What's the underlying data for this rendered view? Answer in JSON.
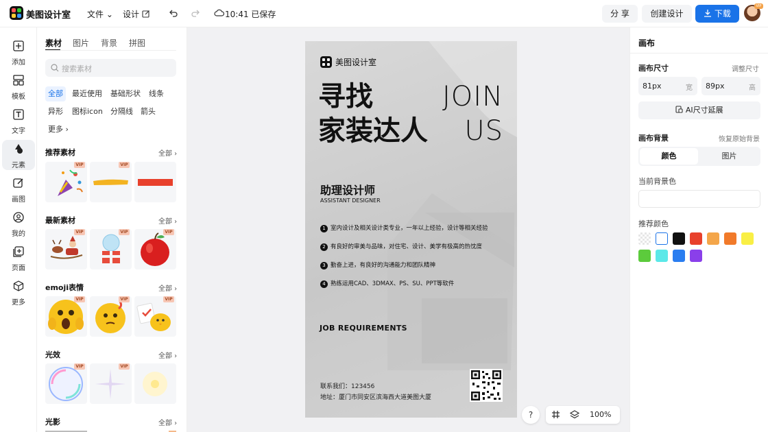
{
  "header": {
    "brand": "美图设计室",
    "file": "文件",
    "design": "设计",
    "save_status": "10:41 已保存",
    "share": "分 享",
    "create": "创建设计",
    "download": "下载"
  },
  "rail": [
    {
      "label": "添加",
      "icon": "plus-square-icon"
    },
    {
      "label": "模板",
      "icon": "template-icon"
    },
    {
      "label": "文字",
      "icon": "text-icon"
    },
    {
      "label": "元素",
      "icon": "element-icon"
    },
    {
      "label": "画图",
      "icon": "draw-icon"
    },
    {
      "label": "我的",
      "icon": "user-icon"
    },
    {
      "label": "页面",
      "icon": "page-icon"
    },
    {
      "label": "更多",
      "icon": "cube-icon"
    }
  ],
  "panel": {
    "tabs": [
      "素材",
      "图片",
      "背景",
      "拼图"
    ],
    "search_placeholder": "搜索素材",
    "chips": [
      "全部",
      "最近使用",
      "基础形状",
      "线条",
      "异形",
      "图标icon",
      "分隔线",
      "箭头",
      "更多"
    ],
    "sections": [
      {
        "title": "推荐素材",
        "all": "全部"
      },
      {
        "title": "最新素材",
        "all": "全部"
      },
      {
        "title": "emoji表情",
        "all": "全部"
      },
      {
        "title": "光效",
        "all": "全部"
      },
      {
        "title": "光影",
        "all": "全部"
      }
    ],
    "vip": "VIP"
  },
  "poster": {
    "brand": "美图设计室",
    "title_l1": "寻找",
    "title_l2": "家装达人",
    "en_l1": "JOIN",
    "en_l2": "US",
    "role": "助理设计师",
    "role_en": "ASSISTANT DESIGNER",
    "reqs": [
      {
        "n": "1",
        "text": "室内设计及相关设计类专业，一年以上经验，设计等相关经验"
      },
      {
        "n": "2",
        "text": "有良好的审美与品味，对住宅、设计、美学有极高的热忱度"
      },
      {
        "n": "3",
        "text": "勤奋上进，有良好的沟通能力和团队精神"
      },
      {
        "n": "4",
        "text": "熟练运用CAD、3DMAX、PS、SU、PPT等软件"
      }
    ],
    "job_req": "JOB REQUIREMENTS",
    "contact": "联系我们：123456",
    "address": "地址：厦门市同安区滨海西大道美图大厦"
  },
  "canvas_tools": {
    "help": "?",
    "zoom": "100%"
  },
  "right": {
    "title": "画布",
    "size_label": "画布尺寸",
    "size_adjust": "调整尺寸",
    "width_val": "81px",
    "width_unit": "宽",
    "height_val": "89px",
    "height_unit": "高",
    "ai_extend": "AI尺寸延展",
    "bg_label": "画布背景",
    "bg_restore": "恢复原始背景",
    "bg_tabs": [
      "颜色",
      "图片"
    ],
    "current_bg": "当前背景色",
    "recommend": "推荐颜色",
    "colors": [
      "transparent",
      "#ffffff",
      "#111111",
      "#e8412c",
      "#f4a64a",
      "#f17a2a",
      "#f9ef45",
      "#5ccb3c",
      "#5be8e8",
      "#2a7df0",
      "#8a3fea"
    ]
  },
  "accent": "#1a73e8"
}
